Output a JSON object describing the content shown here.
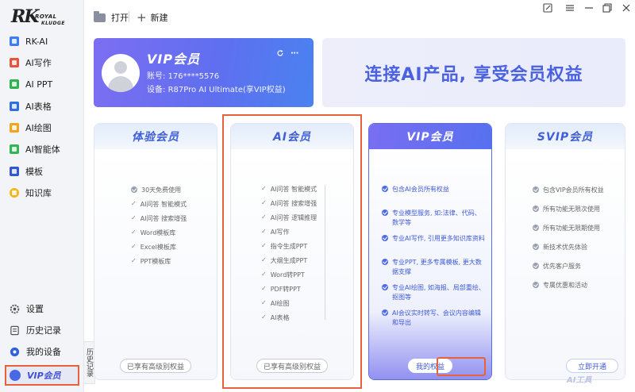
{
  "brand": {
    "logo_main": "RK",
    "logo_sub1": "ROYAL",
    "logo_sub2": "KLUDGE"
  },
  "toolbar": {
    "open_label": "打开",
    "new_label": "新建"
  },
  "sidebar": {
    "items": [
      {
        "label": "RK-AI",
        "icon": "rk-ai-icon"
      },
      {
        "label": "AI写作",
        "icon": "ai-write-icon"
      },
      {
        "label": "AI PPT",
        "icon": "ai-ppt-icon"
      },
      {
        "label": "AI表格",
        "icon": "ai-table-icon"
      },
      {
        "label": "AI绘图",
        "icon": "ai-draw-icon"
      },
      {
        "label": "AI智能体",
        "icon": "ai-agent-icon"
      },
      {
        "label": "模板",
        "icon": "template-icon"
      },
      {
        "label": "知识库",
        "icon": "knowledge-base-icon"
      }
    ],
    "bottom": {
      "settings": "设置",
      "history": "历史记录",
      "devices": "我的设备",
      "vip": "VIP会员"
    },
    "history_tab": "历史记录"
  },
  "user_card": {
    "title": "VIP会员",
    "account_label": "账号:",
    "account_value": "176****5576",
    "device_label": "设备:",
    "device_value": "R87Pro AI Ultimate(享VIP权益)"
  },
  "slogan": "连接AI产品, 享受会员权益",
  "plans": {
    "trial": {
      "title": "体验会员",
      "features": [
        "30天免费使用",
        "AI问答 智能模式",
        "AI问答 搜索增强",
        "Word模板库",
        "Excel模板库",
        "PPT模板库"
      ],
      "button": "已享有高级别权益"
    },
    "ai": {
      "title": "AI会员",
      "features": [
        "AI问答 智能模式",
        "AI问答 搜索增强",
        "AI问答 逻辑推理",
        "AI写作",
        "指令生成PPT",
        "大纲生成PPT",
        "Word转PPT",
        "PDF转PPT",
        "AI绘图",
        "AI表格"
      ],
      "button": "已享有高级别权益"
    },
    "vip": {
      "title": "VIP会员",
      "features": [
        "包含AI会员所有权益",
        "专业模型服务, 如:法律、代码、数学等",
        "专业AI写作, 引用更多知识库资料",
        "专业PPT, 更多专属模板, 更大数据支撑",
        "专业AI绘图, 如海报、局部重绘、抠图等",
        "AI会议实时转写、会议内容编辑和导出"
      ],
      "button": "我的权益"
    },
    "svip": {
      "title": "SVIP会员",
      "features": [
        "包含VIP会员所有权益",
        "所有功能无限次使用",
        "所有功能无限期使用",
        "新技术优先体验",
        "优先客户服务",
        "专属优惠和活动"
      ],
      "button": "立即开通"
    }
  },
  "watermark": "AI工具"
}
